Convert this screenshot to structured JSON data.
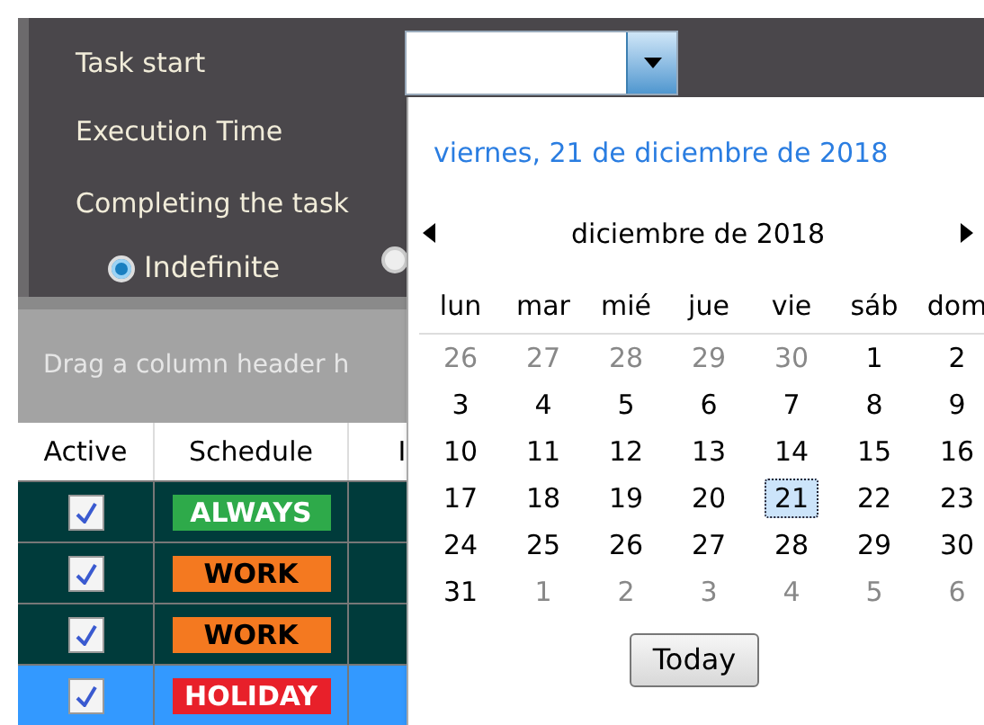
{
  "form": {
    "fields": [
      {
        "label": "Task start"
      },
      {
        "label": "Execution Time"
      },
      {
        "label": "Completing the task"
      }
    ],
    "completion_options": [
      {
        "label": "Indefinite",
        "selected": true
      },
      {
        "selected": false
      }
    ]
  },
  "grid": {
    "group_panel": "Drag a column header h",
    "columns": [
      "Active",
      "Schedule",
      "I"
    ],
    "rows": [
      {
        "active": true,
        "schedule": "ALWAYS",
        "color": "#2eaa4a",
        "selected": false
      },
      {
        "active": true,
        "schedule": "WORK",
        "color": "#f47920",
        "selected": false
      },
      {
        "active": true,
        "schedule": "WORK",
        "color": "#f47920",
        "selected": false
      },
      {
        "active": true,
        "schedule": "HOLIDAY",
        "color": "#e8202a",
        "selected": true
      }
    ]
  },
  "calendar": {
    "today_label": "viernes, 21 de diciembre de 2018",
    "month": "diciembre de 2018",
    "weekdays": [
      "lun",
      "mar",
      "mié",
      "jue",
      "vie",
      "sáb",
      "dom"
    ],
    "days": [
      {
        "day": "26",
        "other_month": true,
        "selected": false
      },
      {
        "day": "27",
        "other_month": true,
        "selected": false
      },
      {
        "day": "28",
        "other_month": true,
        "selected": false
      },
      {
        "day": "29",
        "other_month": true,
        "selected": false
      },
      {
        "day": "30",
        "other_month": true,
        "selected": false
      },
      {
        "day": "1",
        "other_month": false,
        "selected": false
      },
      {
        "day": "2",
        "other_month": false,
        "selected": false
      },
      {
        "day": "3",
        "other_month": false,
        "selected": false
      },
      {
        "day": "4",
        "other_month": false,
        "selected": false
      },
      {
        "day": "5",
        "other_month": false,
        "selected": false
      },
      {
        "day": "6",
        "other_month": false,
        "selected": false
      },
      {
        "day": "7",
        "other_month": false,
        "selected": false
      },
      {
        "day": "8",
        "other_month": false,
        "selected": false
      },
      {
        "day": "9",
        "other_month": false,
        "selected": false
      },
      {
        "day": "10",
        "other_month": false,
        "selected": false
      },
      {
        "day": "11",
        "other_month": false,
        "selected": false
      },
      {
        "day": "12",
        "other_month": false,
        "selected": false
      },
      {
        "day": "13",
        "other_month": false,
        "selected": false
      },
      {
        "day": "14",
        "other_month": false,
        "selected": false
      },
      {
        "day": "15",
        "other_month": false,
        "selected": false
      },
      {
        "day": "16",
        "other_month": false,
        "selected": false
      },
      {
        "day": "17",
        "other_month": false,
        "selected": false
      },
      {
        "day": "18",
        "other_month": false,
        "selected": false
      },
      {
        "day": "19",
        "other_month": false,
        "selected": false
      },
      {
        "day": "20",
        "other_month": false,
        "selected": false
      },
      {
        "day": "21",
        "other_month": false,
        "selected": true
      },
      {
        "day": "22",
        "other_month": false,
        "selected": false
      },
      {
        "day": "23",
        "other_month": false,
        "selected": false
      },
      {
        "day": "24",
        "other_month": false,
        "selected": false
      },
      {
        "day": "25",
        "other_month": false,
        "selected": false
      },
      {
        "day": "26",
        "other_month": false,
        "selected": false
      },
      {
        "day": "27",
        "other_month": false,
        "selected": false
      },
      {
        "day": "28",
        "other_month": false,
        "selected": false
      },
      {
        "day": "29",
        "other_month": false,
        "selected": false
      },
      {
        "day": "30",
        "other_month": false,
        "selected": false
      },
      {
        "day": "31",
        "other_month": false,
        "selected": false
      },
      {
        "day": "1",
        "other_month": true,
        "selected": false
      },
      {
        "day": "2",
        "other_month": true,
        "selected": false
      },
      {
        "day": "3",
        "other_month": true,
        "selected": false
      },
      {
        "day": "4",
        "other_month": true,
        "selected": false
      },
      {
        "day": "5",
        "other_month": true,
        "selected": false
      },
      {
        "day": "6",
        "other_month": true,
        "selected": false
      }
    ],
    "today_button": "Today"
  }
}
